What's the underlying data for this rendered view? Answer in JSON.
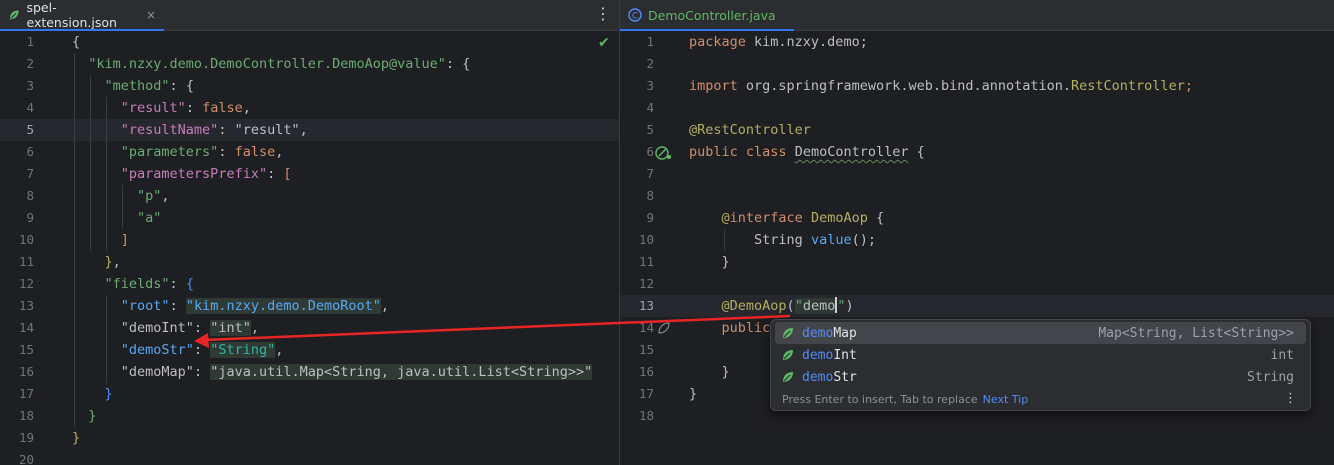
{
  "left_tab": {
    "title": "spel-extension.json",
    "close": "×",
    "icon": "json-leaf-icon"
  },
  "left_menu": "⋮",
  "right_tab": {
    "title": "DemoController.java",
    "icon": "class-icon",
    "icon_letter": "C"
  },
  "left_lines": {
    "1": "1",
    "2": "2",
    "3": "3",
    "4": "4",
    "5": "5",
    "6": "6",
    "7": "7",
    "8": "8",
    "9": "9",
    "10": "10",
    "11": "11",
    "12": "12",
    "13": "13",
    "14": "14",
    "15": "15",
    "16": "16",
    "17": "17",
    "18": "18",
    "19": "19",
    "20": "20"
  },
  "right_lines": {
    "1": "1",
    "2": "2",
    "3": "3",
    "4": "4",
    "5": "5",
    "6": "6",
    "7": "7",
    "8": "8",
    "9": "9",
    "10": "10",
    "11": "11",
    "12": "12",
    "13": "13",
    "14": "14",
    "15": "15",
    "16": "16",
    "17": "17",
    "18": "18"
  },
  "json": {
    "open": "{",
    "root_key": "\"kim.nzxy.demo.DemoController.DemoAop@value\"",
    "method_key": "\"method\"",
    "result_key": "\"result\"",
    "false": "false",
    "result_name_key": "\"resultName\"",
    "result_name_val": "\"result\"",
    "parameters_key": "\"parameters\"",
    "prefix_key": "\"parametersPrefix\"",
    "p": "\"p\"",
    "a": "\"a\"",
    "fields_key": "\"fields\"",
    "root_field_key": "\"root\"",
    "root_field_val": "\"kim.nzxy.demo.DemoRoot\"",
    "demoint_key": "\"demoInt\"",
    "demoint_val": "\"int\"",
    "demostr_key": "\"demoStr\"",
    "demostr_val": "\"String\"",
    "demomap_key": "\"demoMap\"",
    "demomap_val": "\"java.util.Map<String, java.util.List<String>>\"",
    "close": "}"
  },
  "java": {
    "package_kw": "package",
    "package_name": " kim.nzxy.demo;",
    "import_kw": "import",
    "import_pkg": " org.springframework.web.bind.annotation.",
    "import_cls": "RestController",
    "semicolon": ";",
    "rest_ann": "@RestController",
    "public_class_kw": "public class",
    "class_name": "DemoController",
    "brace_open": " {",
    "interface_at": "@",
    "interface_kw": "interface",
    "interface_name": " DemoAop",
    "string_type": "String",
    "value_method": " value",
    "parens": "();",
    "brace_close": "}",
    "demo_ann": "@DemoAop",
    "paren_open": "(",
    "quote": "\"",
    "typed": "demo",
    "paren_close": ")",
    "public_kw": "public"
  },
  "completion": {
    "items": [
      {
        "match": "demo",
        "rest": "Map",
        "type": "Map<String, List<String>>"
      },
      {
        "match": "demo",
        "rest": "Int",
        "type": "int"
      },
      {
        "match": "demo",
        "rest": "Str",
        "type": "String"
      }
    ],
    "footer": "Press Enter to insert, Tab to replace",
    "next_tip": "Next Tip",
    "more": "⋮"
  },
  "colors": {
    "accent": "#3574f0",
    "arrow": "#e82525",
    "check": "#5fb865",
    "leaf": "#5fb865"
  }
}
